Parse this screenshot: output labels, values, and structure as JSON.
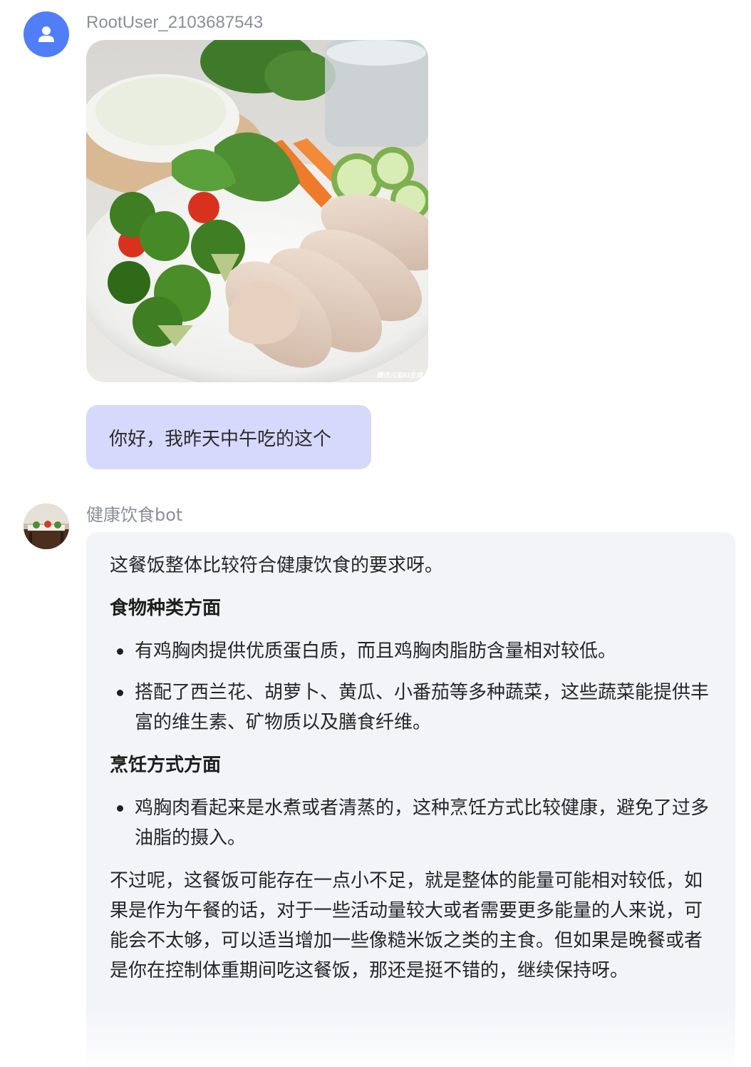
{
  "user": {
    "name": "RootUser_2103687543",
    "image_watermark": "腾讯元宝AI生成",
    "message": "你好，我昨天中午吃的这个"
  },
  "bot": {
    "name": "健康饮食bot",
    "intro": "这餐饭整体比较符合健康饮食的要求呀。",
    "section1": {
      "heading": "食物种类方面",
      "items": [
        "有鸡胸肉提供优质蛋白质，而且鸡胸肉脂肪含量相对较低。",
        "搭配了西兰花、胡萝卜、黄瓜、小番茄等多种蔬菜，这些蔬菜能提供丰富的维生素、矿物质以及膳食纤维。"
      ]
    },
    "section2": {
      "heading": "烹饪方式方面",
      "items": [
        "鸡胸肉看起来是水煮或者清蒸的，这种烹饪方式比较健康，避免了过多油脂的摄入。"
      ]
    },
    "conclusion": "不过呢，这餐饭可能存在一点小不足，就是整体的能量可能相对较低，如果是作为午餐的话，对于一些活动量较大或者需要更多能量的人来说，可能会不太够，可以适当增加一些像糙米饭之类的主食。但如果是晚餐或者是你在控制体重期间吃这餐饭，那还是挺不错的，继续保持呀。"
  },
  "colors": {
    "user_avatar": "#4f7ef7",
    "user_bubble": "#d6d9fb",
    "bot_bubble": "#f3f4f8",
    "name_text": "#8b8f98"
  },
  "icons": {
    "user_avatar": "person-icon"
  }
}
